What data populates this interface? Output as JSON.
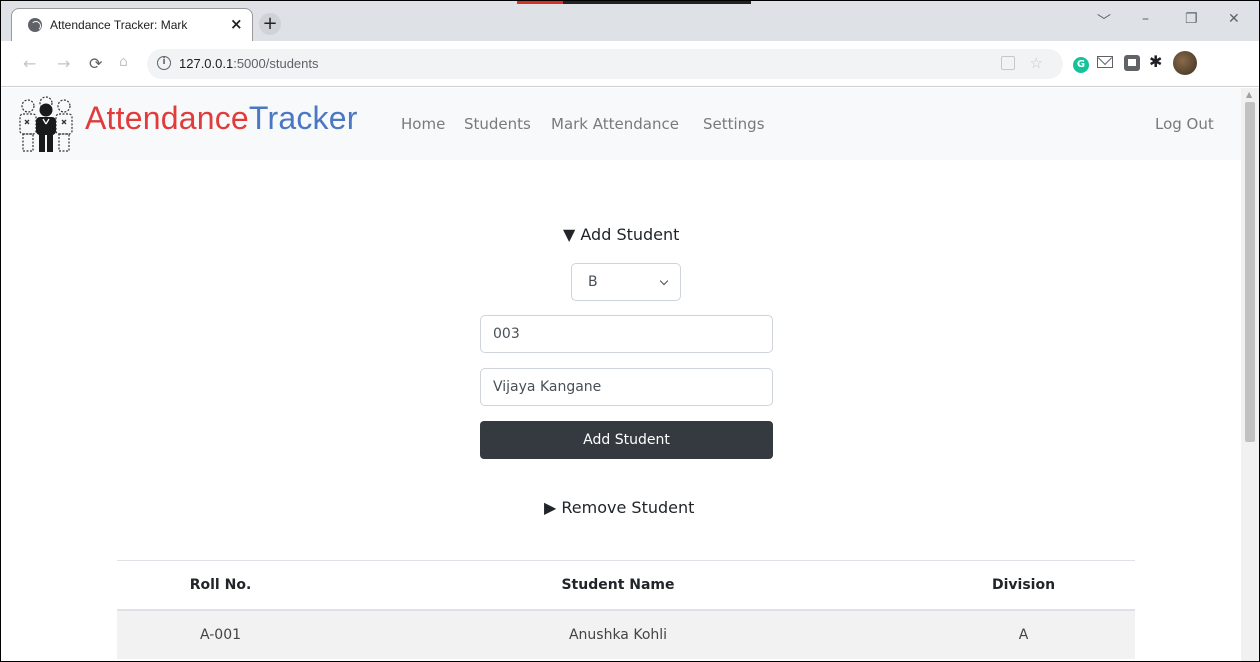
{
  "browser": {
    "tab_title": "Attendance Tracker: Mark",
    "tab_close": "×",
    "new_tab": "+",
    "url_host": "127.0.0.1",
    "url_path": ":5000/students",
    "window_controls": [
      "﹀",
      "–",
      "❐",
      "✕"
    ]
  },
  "navbar": {
    "brand_part1": "Attendance",
    "brand_part2": "Tracker",
    "links": [
      "Home",
      "Students",
      "Mark Attendance",
      "Settings"
    ],
    "logout": "Log Out"
  },
  "add_student": {
    "summary": "▼ Add Student",
    "division_selected": "B",
    "roll_value": "003",
    "name_value": "Vijaya Kangane",
    "button_label": "Add Student"
  },
  "remove_student": {
    "summary": "▶ Remove Student"
  },
  "table": {
    "headers": [
      "Roll No.",
      "Student Name",
      "Division"
    ],
    "rows": [
      [
        "A-001",
        "Anushka Kohli",
        "A"
      ]
    ]
  },
  "colors": {
    "brand_red": "#e03c3c",
    "brand_blue": "#4a78c2",
    "button_dark": "#343a40"
  }
}
